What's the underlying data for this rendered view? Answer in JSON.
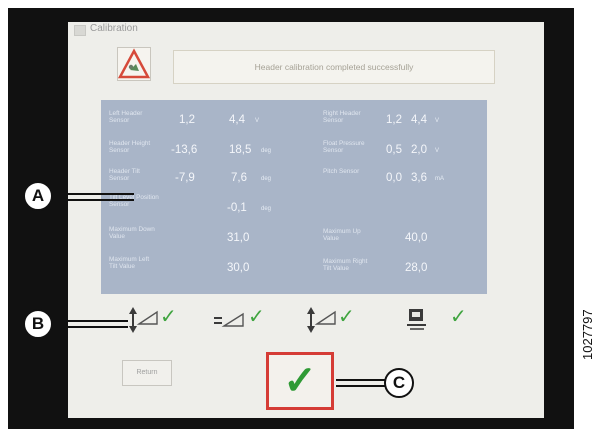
{
  "screen": {
    "title": "Calibration",
    "message": "Header calibration completed successfully",
    "return_label": "Return"
  },
  "sensors": {
    "left_header": {
      "label": "Left Header Sensor",
      "value1": "1,2",
      "value2": "4,4",
      "unit": "V"
    },
    "right_header": {
      "label": "Right Header Sensor",
      "value1": "1,2",
      "value2": "4,4",
      "unit": "V"
    },
    "header_height": {
      "label": "Header Height Sensor",
      "value1": "-13,6",
      "value2": "18,5",
      "unit": "deg"
    },
    "float_pressure": {
      "label": "Float Pressure Sensor",
      "value1": "0,5",
      "value2": "2,0",
      "unit": "V"
    },
    "header_tilt": {
      "label": "Header Tilt Sensor",
      "value1": "-7,9",
      "value2": "7,6",
      "unit": "deg"
    },
    "pitch": {
      "label": "Pitch Sensor",
      "value1": "0,0",
      "value2": "3,6",
      "unit": "mA"
    },
    "tilt_level": {
      "label": "Tilt Level Position Sensor",
      "value": "-0,1",
      "unit": "deg"
    },
    "max_down": {
      "label": "Maximum Down Value",
      "value": "31,0"
    },
    "max_up": {
      "label": "Maximum Up Value",
      "value": "40,0"
    },
    "max_left_tilt": {
      "label": "Maximum Left Tilt Value",
      "value": "30,0"
    },
    "max_right_tilt": {
      "label": "Maximum Right Tilt Value",
      "value": "28,0"
    }
  },
  "status_icons": [
    "height-calibrated-icon",
    "float-calibrated-icon",
    "tilt-calibrated-icon",
    "monitor-calibrated-icon"
  ],
  "callouts": {
    "a": "A",
    "b": "B",
    "c": "C"
  },
  "doc_number": "1027797",
  "colors": {
    "panel": "#a9b5c8",
    "check": "#3fa43f",
    "confirm_border": "#d53c36"
  }
}
